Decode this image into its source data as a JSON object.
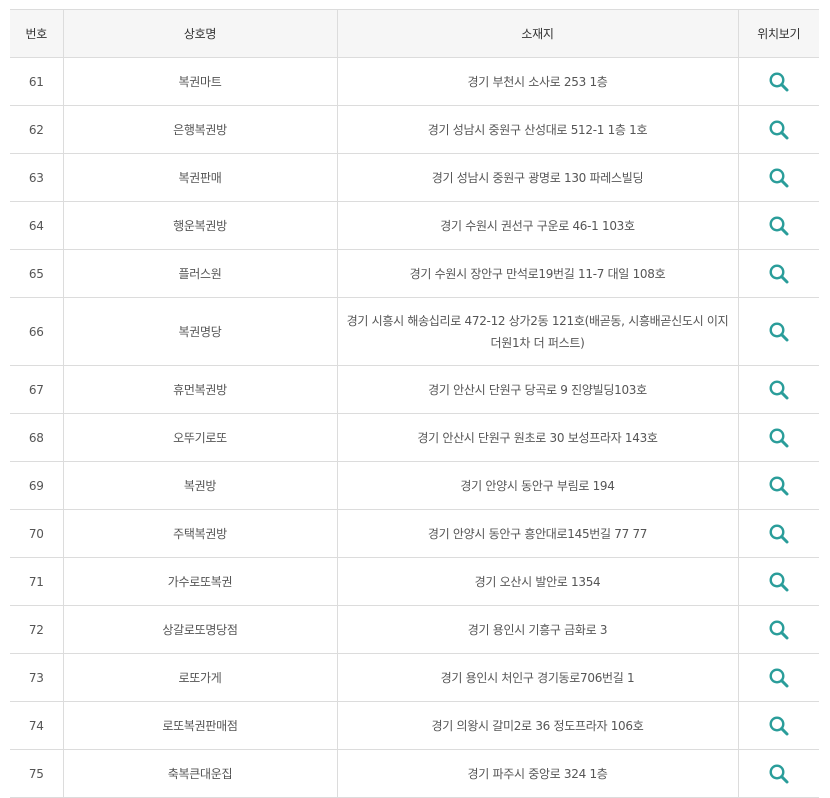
{
  "table": {
    "headers": {
      "no": "번호",
      "name": "상호명",
      "address": "소재지",
      "location": "위치보기"
    },
    "rows": [
      {
        "no": "61",
        "name": "복권마트",
        "address": "경기 부천시 소사로 253 1층"
      },
      {
        "no": "62",
        "name": "은행복권방",
        "address": "경기 성남시 중원구 산성대로 512-1 1층 1호"
      },
      {
        "no": "63",
        "name": "복권판매",
        "address": "경기 성남시 중원구 광명로 130 파레스빌딩"
      },
      {
        "no": "64",
        "name": "행운복권방",
        "address": "경기 수원시 권선구 구운로 46-1 103호"
      },
      {
        "no": "65",
        "name": "플러스원",
        "address": "경기 수원시 장안구 만석로19번길 11-7 대일 108호"
      },
      {
        "no": "66",
        "name": "복권명당",
        "address": "경기 시흥시 해송십리로 472-12 상가2동 121호(배곧동, 시흥배곧신도시 이지더원1차 더 퍼스트)"
      },
      {
        "no": "67",
        "name": "휴먼복권방",
        "address": "경기 안산시 단원구 당곡로 9 진양빌딩103호"
      },
      {
        "no": "68",
        "name": "오뚜기로또",
        "address": "경기 안산시 단원구 원초로 30 보성프라자 143호"
      },
      {
        "no": "69",
        "name": "복권방",
        "address": "경기 안양시 동안구 부림로 194"
      },
      {
        "no": "70",
        "name": "주택복권방",
        "address": "경기 안양시 동안구 흥안대로145번길 77 77"
      },
      {
        "no": "71",
        "name": "가수로또복권",
        "address": "경기 오산시 발안로 1354"
      },
      {
        "no": "72",
        "name": "상갈로또명당점",
        "address": "경기 용인시 기흥구 금화로 3"
      },
      {
        "no": "73",
        "name": "로또가게",
        "address": "경기 용인시 처인구 경기동로706번길 1"
      },
      {
        "no": "74",
        "name": "로또복권판매점",
        "address": "경기 의왕시 갈미2로 36 정도프라자 106호"
      },
      {
        "no": "75",
        "name": "축복큰대운집",
        "address": "경기 파주시 중앙로 324 1층"
      }
    ]
  },
  "icons": {
    "location": "search-icon"
  },
  "colors": {
    "accent": "#2a9d9a",
    "header_bg": "#f6f6f6",
    "top_border": "#444444",
    "grid": "#dcdcdc"
  }
}
